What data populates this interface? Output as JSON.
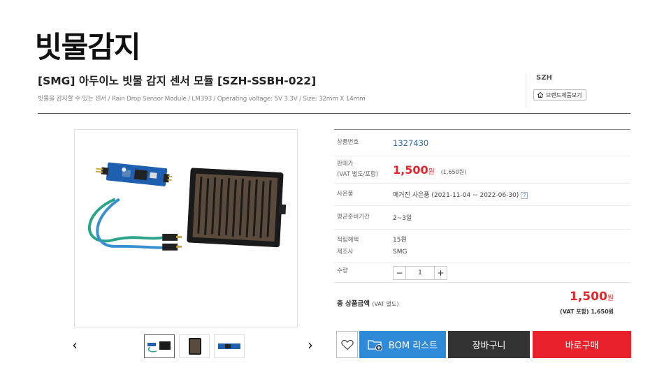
{
  "slide": {
    "title": "빗물감지"
  },
  "product": {
    "name": "[SMG] 아두이노 빗물 감지 센서 모듈 [SZH-SSBH-022]",
    "description": "빗물을 감지할 수 있는 센서 / Rain Drop Sensor Module / LM393 / Operating voltage: 5V 3.3V / Size: 32mm X 14mm"
  },
  "brand": {
    "name": "SZH",
    "button_label": "브랜드제품보기"
  },
  "gallery": {
    "prev": "‹",
    "next": "›",
    "thumbnail_count": 3
  },
  "info": {
    "code_label": "상품번호",
    "code_value": "1327430",
    "price_label_1": "판매가",
    "price_label_2": "(VAT 별도/포함)",
    "price_value": "1,500",
    "price_unit": "원",
    "price_vat": "(1,650원)",
    "gift_label": "사은품",
    "gift_value": "매거진 사은품 (2021-11-04 ~ 2022-06-30)",
    "gift_help": "?",
    "lead_label": "평균준비기간",
    "lead_value": "2~3일",
    "points_label": "적립혜택",
    "points_value": "15원",
    "maker_label": "제조사",
    "maker_value": "SMG",
    "qty_label": "수량",
    "qty_minus": "−",
    "qty_value": "1",
    "qty_plus": "+"
  },
  "total": {
    "label": "총 상품금액",
    "label_note": "(VAT 별도)",
    "price": "1,500",
    "unit": "원",
    "vat_note": "(VAT 포함) 1,650원"
  },
  "buttons": {
    "bom": "BOM 리스트",
    "cart": "장바구니",
    "buy": "바로구매"
  },
  "colors": {
    "price_red": "#e3262b",
    "bom_blue": "#2f8ad8",
    "cart_dark": "#333333",
    "buy_red": "#e8212a",
    "code_blue": "#2b6cb0"
  }
}
